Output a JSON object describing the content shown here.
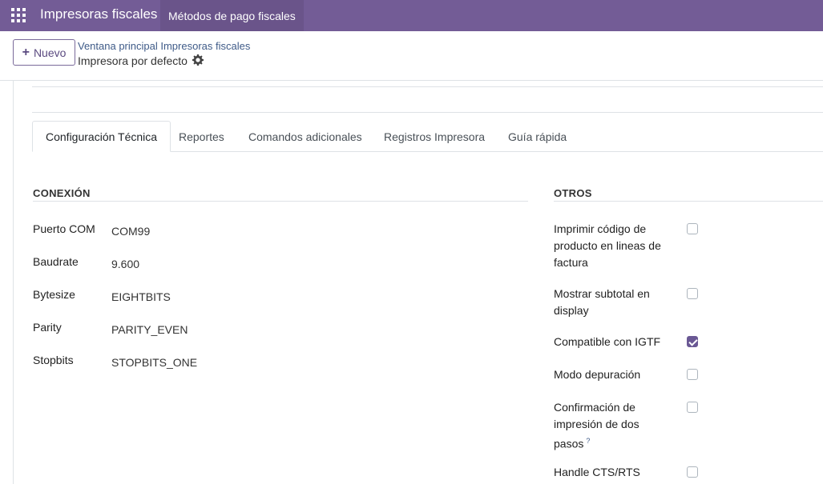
{
  "navbar": {
    "app_title": "Impresoras fiscales",
    "menu_item": "Métodos de pago fiscales"
  },
  "control_panel": {
    "new_label": "Nuevo",
    "breadcrumb": "Ventana principal Impresoras fiscales",
    "record_name": "Impresora por defecto"
  },
  "tabs": [
    {
      "label": "Configuración Técnica",
      "active": true
    },
    {
      "label": "Reportes"
    },
    {
      "label": "Comandos adicionales"
    },
    {
      "label": "Registros Impresora"
    },
    {
      "label": "Guía rápida"
    }
  ],
  "conexion": {
    "title": "CONEXIÓN",
    "fields": [
      {
        "label": "Puerto COM",
        "value": "COM99"
      },
      {
        "label": "Baudrate",
        "value": "9.600"
      },
      {
        "label": "Bytesize",
        "value": "EIGHTBITS"
      },
      {
        "label": "Parity",
        "value": "PARITY_EVEN"
      },
      {
        "label": "Stopbits",
        "value": "STOPBITS_ONE"
      }
    ]
  },
  "otros": {
    "title": "OTROS",
    "fields": [
      {
        "label": "Imprimir código de producto en lineas de factura",
        "checked": false
      },
      {
        "label": "Mostrar subtotal en display",
        "checked": false
      },
      {
        "label": "Compatible con IGTF",
        "checked": true
      },
      {
        "label": "Modo depuración",
        "checked": false
      },
      {
        "label": "Confirmación de impresión de dos pasos",
        "checked": false,
        "help": "?"
      },
      {
        "label": "Handle CTS/RTS",
        "checked": false
      }
    ]
  },
  "colors": {
    "navbar": "#735c96",
    "accent": "#6a5894"
  }
}
